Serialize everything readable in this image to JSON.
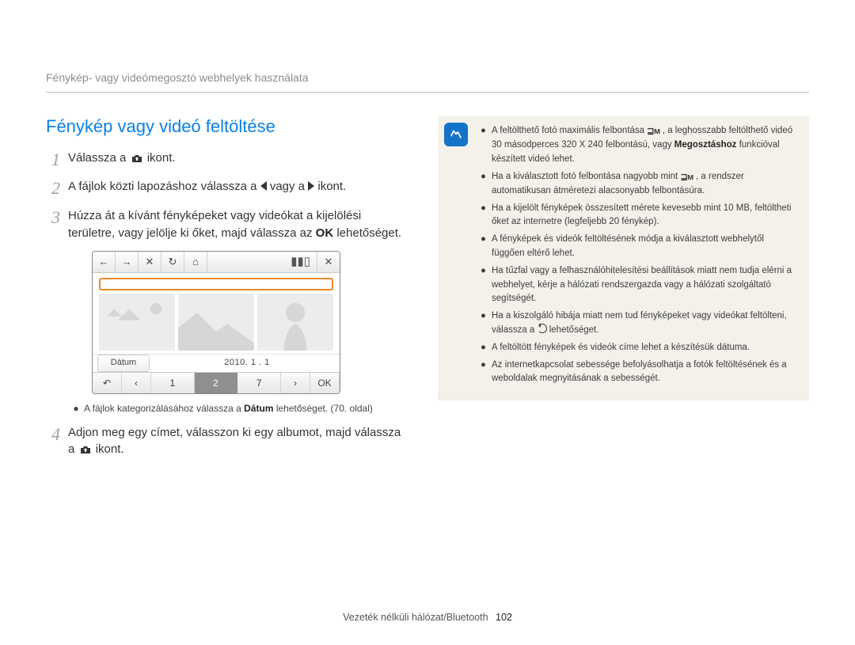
{
  "breadcrumb": "Fénykép- vagy videómegosztó webhelyek használata",
  "section_title": "Fénykép vagy videó feltöltése",
  "steps": {
    "s1": {
      "pre": "Válassza a ",
      "post": " ikont."
    },
    "s2": {
      "pre": "A fájlok közti lapozáshoz válassza a ",
      "mid": " vagy a ",
      "post": " ikont."
    },
    "s3": {
      "text_a": "Húzza át a kívánt fényképeket vagy videókat a kijelölési területre, vagy jelölje ki őket, majd válassza az ",
      "ok": "OK",
      "text_b": " lehetőséget."
    },
    "s3_sub": {
      "text_a": "A fájlok kategorizálásához válassza a ",
      "b": "Dátum",
      "text_b": " lehetőséget. (70. oldal)"
    },
    "s4": {
      "text_a": "Adjon meg egy címet, válasszon ki egy albumot, majd válassza a ",
      "text_b": " ikont."
    }
  },
  "device": {
    "category_label": "Dátum",
    "date_value": "2010. 1 . 1",
    "pager": {
      "a": "1",
      "b": "2",
      "c": "7"
    },
    "ok_label": "OK"
  },
  "notes": [
    {
      "text_a": "A feltölthető fotó maximális felbontása ",
      "icon": "sig",
      "text_b": ", a leghosszabb feltölthető videó 30 másodperces 320 X 240 felbontású, vagy ",
      "b": "Megosztáshoz",
      "text_c": " funkcióval készített videó lehet."
    },
    {
      "text_a": "Ha a kiválasztott fotó felbontása nagyobb mint ",
      "icon": "sig",
      "text_b": ", a rendszer automatikusan átméretezi alacsonyabb felbontásúra."
    },
    {
      "text": "Ha a kijelölt fényképek összesített mérete kevesebb mint 10 MB, feltöltheti őket az internetre (legfeljebb 20 fénykép)."
    },
    {
      "text": "A fényképek és videók feltöltésének módja a kiválasztott webhelytől függően eltérő lehet."
    },
    {
      "text": "Ha tűzfal vagy a felhasználóhitelesítési beállítások miatt nem tudja elérni a webhelyet, kérje a hálózati rendszergazda vagy a hálózati szolgáltató segítségét."
    },
    {
      "text_a": "Ha a kiszolgáló hibája miatt nem tud fényképeket vagy videókat feltölteni, válassza a ",
      "icon": "refresh",
      "text_b": " lehetőséget."
    },
    {
      "text": "A feltöltött fényképek és videók címe lehet a készítésük dátuma."
    },
    {
      "text": "Az internetkapcsolat sebessége befolyásolhatja a fotók feltöltésének és a weboldalak megnyitásának a sebességét."
    }
  ],
  "footer": {
    "section": "Vezeték nélküli hálózat/Bluetooth",
    "page": "102"
  }
}
